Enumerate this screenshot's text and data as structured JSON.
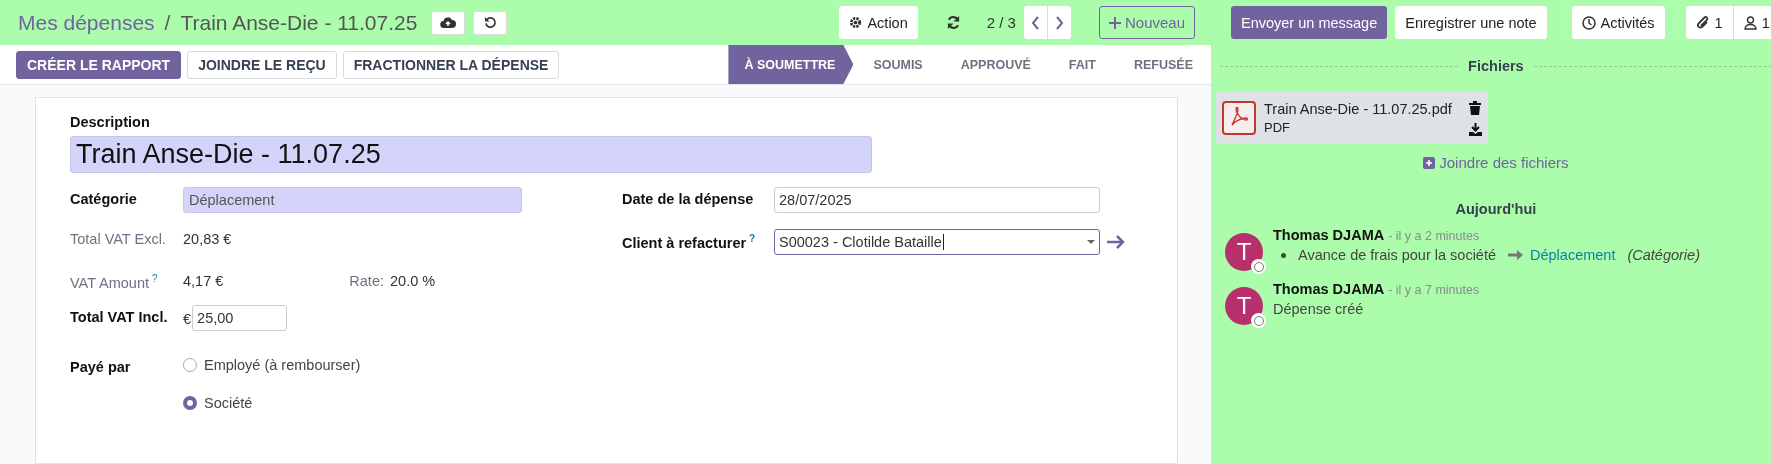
{
  "breadcrumb": {
    "parent": "Mes dépenses",
    "separator": "/",
    "current": "Train Anse-Die - 11.07.25"
  },
  "action_button": "Action",
  "pager": "2 / 3",
  "new_button": "Nouveau",
  "chatter_actions": [
    {
      "label": "Envoyer un message",
      "selected": true
    },
    {
      "label": "Enregistrer une note",
      "selected": false
    }
  ],
  "activities_button": "Activités",
  "attachments_count": "1",
  "followers_count": "1",
  "action_buttons": [
    {
      "label": "CRÉER LE RAPPORT",
      "primary": true
    },
    {
      "label": "JOINDRE LE REÇU",
      "primary": false
    },
    {
      "label": "FRACTIONNER LA DÉPENSE",
      "primary": false
    }
  ],
  "statusbar": [
    {
      "label": "À SOUMETTRE",
      "selected": true
    },
    {
      "label": "SOUMIS",
      "selected": false
    },
    {
      "label": "APPROUVÉ",
      "selected": false
    },
    {
      "label": "FAIT",
      "selected": false
    },
    {
      "label": "REFUSÉE",
      "selected": false
    }
  ],
  "form": {
    "description": {
      "label": "Description",
      "value": "Train Anse-Die - 11.07.25"
    },
    "left": [
      {
        "kind": "highlight",
        "label": "Catégorie",
        "value": "Déplacement"
      },
      {
        "kind": "readonly",
        "label": "Total VAT Excl.",
        "value": "20,83 €"
      },
      {
        "kind": "readonly",
        "label": "VAT Amount",
        "help": "?",
        "value": "4,17 €",
        "extra_label": "Rate:",
        "extra_value": "20.0 %"
      },
      {
        "kind": "currency",
        "label": "Total VAT Incl.",
        "currency": "€",
        "value": "25,00"
      },
      {
        "kind": "radio",
        "label": "Payé par",
        "options": [
          {
            "label": "Employé (à rembourser)",
            "selected": false
          },
          {
            "label": "Société",
            "selected": true
          }
        ]
      }
    ],
    "right": [
      {
        "kind": "input",
        "label": "Date de la dépense",
        "value": "28/07/2025"
      },
      {
        "kind": "select",
        "label": "Client à refacturer",
        "help": "?",
        "value": "S00023 - Clotilde Bataille"
      }
    ]
  },
  "chatter": {
    "files_title": "Fichiers",
    "attachments": [
      {
        "name": "Train Anse-Die - 11.07.25.pdf",
        "type": "PDF"
      }
    ],
    "attach_link": "Joindre des fichiers",
    "date_separator": "Aujourd'hui",
    "messages": [
      {
        "kind": "tracking",
        "avatar": "T",
        "author": "Thomas DJAMA",
        "time": "- il y a 2 minutes",
        "old_value": "Avance de frais pour la société",
        "new_value": "Déplacement",
        "field": "(Catégorie)"
      },
      {
        "kind": "text",
        "avatar": "T",
        "author": "Thomas DJAMA",
        "time": "- il y a 7 minutes",
        "body": "Dépense créé"
      }
    ]
  }
}
